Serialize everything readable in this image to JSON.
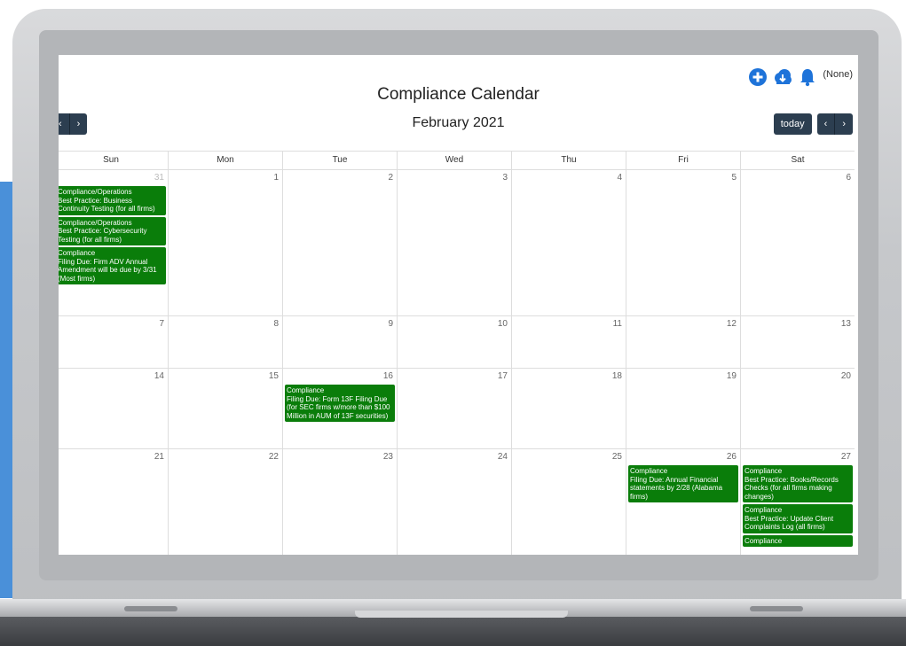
{
  "calendar": {
    "title": "Compliance Calendar",
    "month": "February 2021",
    "prev_label": "‹",
    "next_label": "›",
    "today_label": "today",
    "filter_label": "(None)",
    "weekdays": [
      "Sun",
      "Mon",
      "Tue",
      "Wed",
      "Thu",
      "Fri",
      "Sat"
    ],
    "weeks": [
      {
        "days": [
          {
            "num": "31",
            "other": true,
            "events": [
              {
                "category": "Compliance/Operations",
                "text": "Best Practice: Business Continuity Testing (for all firms)"
              },
              {
                "category": "Compliance/Operations",
                "text": "Best Practice: Cybersecurity Testing (for all firms)"
              },
              {
                "category": "Compliance",
                "text": "Filing Due: Firm ADV Annual Amendment will be due by 3/31 (Most firms)"
              }
            ]
          },
          {
            "num": "1",
            "events": []
          },
          {
            "num": "2",
            "events": []
          },
          {
            "num": "3",
            "events": []
          },
          {
            "num": "4",
            "events": []
          },
          {
            "num": "5",
            "events": []
          },
          {
            "num": "6",
            "events": []
          }
        ]
      },
      {
        "days": [
          {
            "num": "7",
            "events": []
          },
          {
            "num": "8",
            "events": []
          },
          {
            "num": "9",
            "events": []
          },
          {
            "num": "10",
            "events": []
          },
          {
            "num": "11",
            "events": []
          },
          {
            "num": "12",
            "events": []
          },
          {
            "num": "13",
            "events": []
          }
        ]
      },
      {
        "days": [
          {
            "num": "14",
            "events": []
          },
          {
            "num": "15",
            "events": []
          },
          {
            "num": "16",
            "events": [
              {
                "category": "Compliance",
                "text": "Filing Due: Form 13F Filing Due (for SEC firms w/more than $100 Million in AUM of 13F securities)"
              }
            ]
          },
          {
            "num": "17",
            "events": []
          },
          {
            "num": "18",
            "events": []
          },
          {
            "num": "19",
            "events": []
          },
          {
            "num": "20",
            "events": []
          }
        ]
      },
      {
        "days": [
          {
            "num": "21",
            "events": []
          },
          {
            "num": "22",
            "events": []
          },
          {
            "num": "23",
            "events": []
          },
          {
            "num": "24",
            "events": []
          },
          {
            "num": "25",
            "events": []
          },
          {
            "num": "26",
            "events": [
              {
                "category": "Compliance",
                "text": "Filing Due: Annual Financial statements by 2/28 (Alabama firms)"
              }
            ]
          },
          {
            "num": "27",
            "events": [
              {
                "category": "Compliance",
                "text": "Best Practice: Books/Records Checks (for all firms making changes)"
              },
              {
                "category": "Compliance",
                "text": "Best Practice: Update Client Complaints Log (all firms)"
              },
              {
                "category": "Compliance",
                "text": ""
              }
            ]
          }
        ]
      }
    ]
  },
  "colors": {
    "event_bg": "#0a7d0a",
    "button_bg": "#2c3e50",
    "icon_blue": "#1e73d9"
  }
}
